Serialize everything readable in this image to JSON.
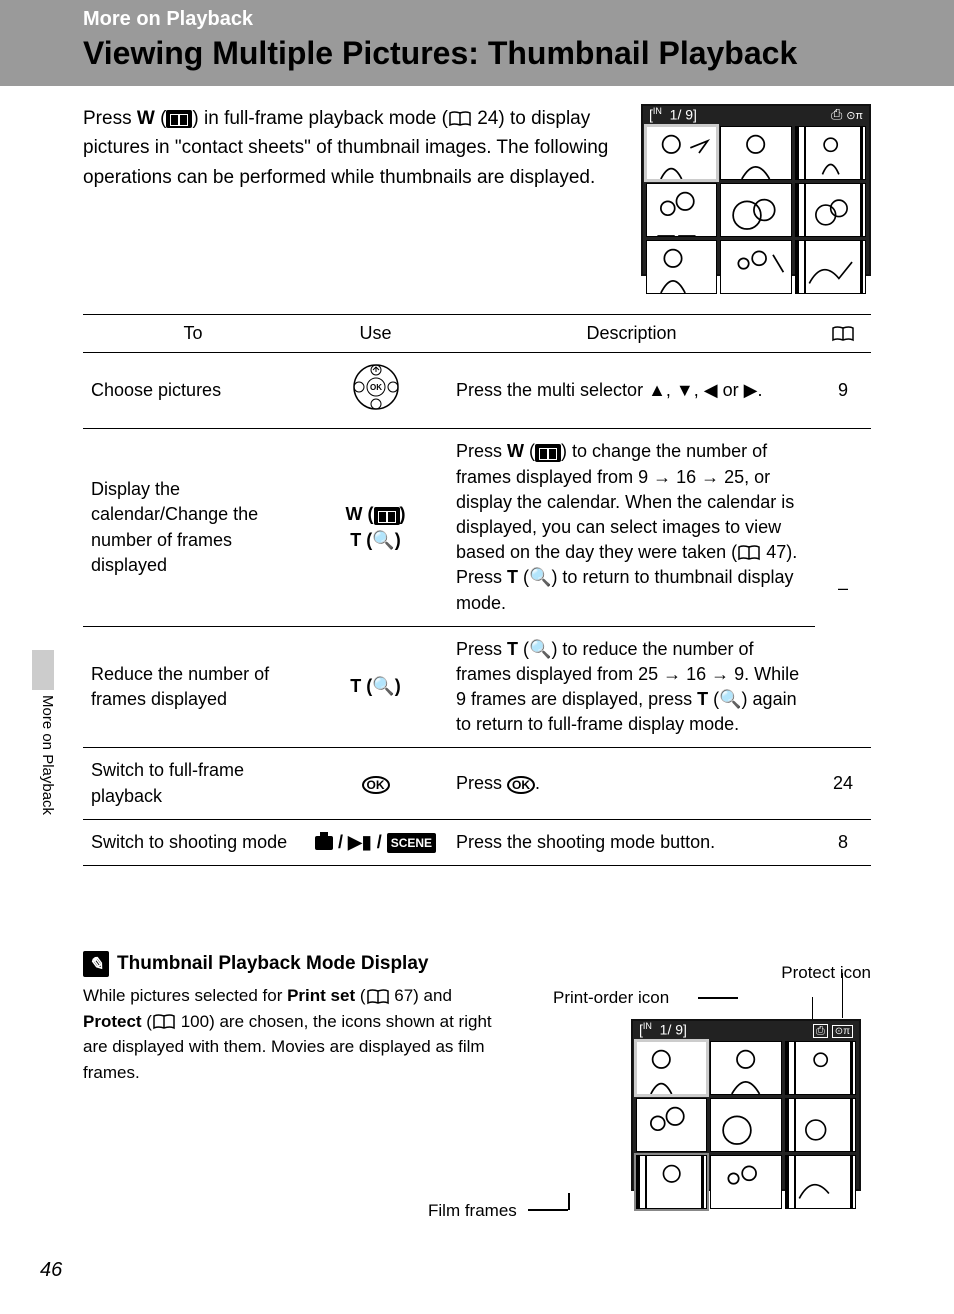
{
  "header": {
    "breadcrumb": "More on Playback",
    "title": "Viewing Multiple Pictures: Thumbnail Playback"
  },
  "intro": {
    "text_before_w": "Press ",
    "w_label": "W",
    "text_after_w": " (",
    "text_after_icon": ") in full-frame playback mode (",
    "ref1": "24",
    "text_mid": ") to display pictures in \"contact sheets\" of thumbnail images. The following operations can be performed while thumbnails are displayed."
  },
  "lcd": {
    "counter": "1/    9"
  },
  "table": {
    "headers": {
      "to": "To",
      "use": "Use",
      "desc": "Description",
      "pg_icon": "book"
    },
    "rows": [
      {
        "to": "Choose pictures",
        "use_type": "multiselector",
        "desc_pre": "Press the multi selector ",
        "desc_mid": ", ",
        "desc_or": " or ",
        "desc_end": ".",
        "pg": "9"
      },
      {
        "to": "Display the calendar/Change the number of frames displayed",
        "use_type": "wt",
        "use_w": "W",
        "use_t": "T",
        "desc_l1_a": "Press ",
        "desc_l1_w": "W",
        "desc_l1_b": " (",
        "desc_l1_c": ") to change the number of frames displayed from 9 → 16 → 25, or display the calendar. When the calendar is displayed, you can select images to view based on the day they were taken (",
        "desc_l1_ref": "47",
        "desc_l1_d": ").",
        "desc_l2_a": "Press ",
        "desc_l2_t": "T",
        "desc_l2_b": " (",
        "desc_l2_c": ") to return to thumbnail display mode.",
        "pg": "–",
        "pg_rowspan": true
      },
      {
        "to": "Reduce the number of frames displayed",
        "use_type": "t",
        "use_t": "T",
        "desc_a": "Press ",
        "desc_t": "T",
        "desc_b": " (",
        "desc_c": ") to reduce the number of frames displayed from 25 → 16 → 9. While 9 frames are displayed, press ",
        "desc_t2": "T",
        "desc_d": " (",
        "desc_e": ") again to return to full-frame display mode."
      },
      {
        "to": "Switch to full-frame playback",
        "use_type": "ok",
        "desc_a": "Press ",
        "desc_b": ".",
        "pg": "24"
      },
      {
        "to": "Switch to shooting mode",
        "use_type": "shoot",
        "scene": "SCENE",
        "desc": "Press the shooting mode button.",
        "pg": "8"
      }
    ]
  },
  "note": {
    "heading": "Thumbnail Playback Mode Display",
    "text_a": "While pictures selected for ",
    "bold1": "Print set",
    "text_b": " (",
    "ref1": "67",
    "text_c": ") and ",
    "bold2": "Protect",
    "text_d": " (",
    "ref2": "100",
    "text_e": ") are chosen, the icons shown at right are displayed with them. Movies are displayed as film frames.",
    "label_protect": "Protect icon",
    "label_print": "Print-order icon",
    "label_film": "Film frames"
  },
  "side_tab": "More on Playback",
  "page_number": "46"
}
